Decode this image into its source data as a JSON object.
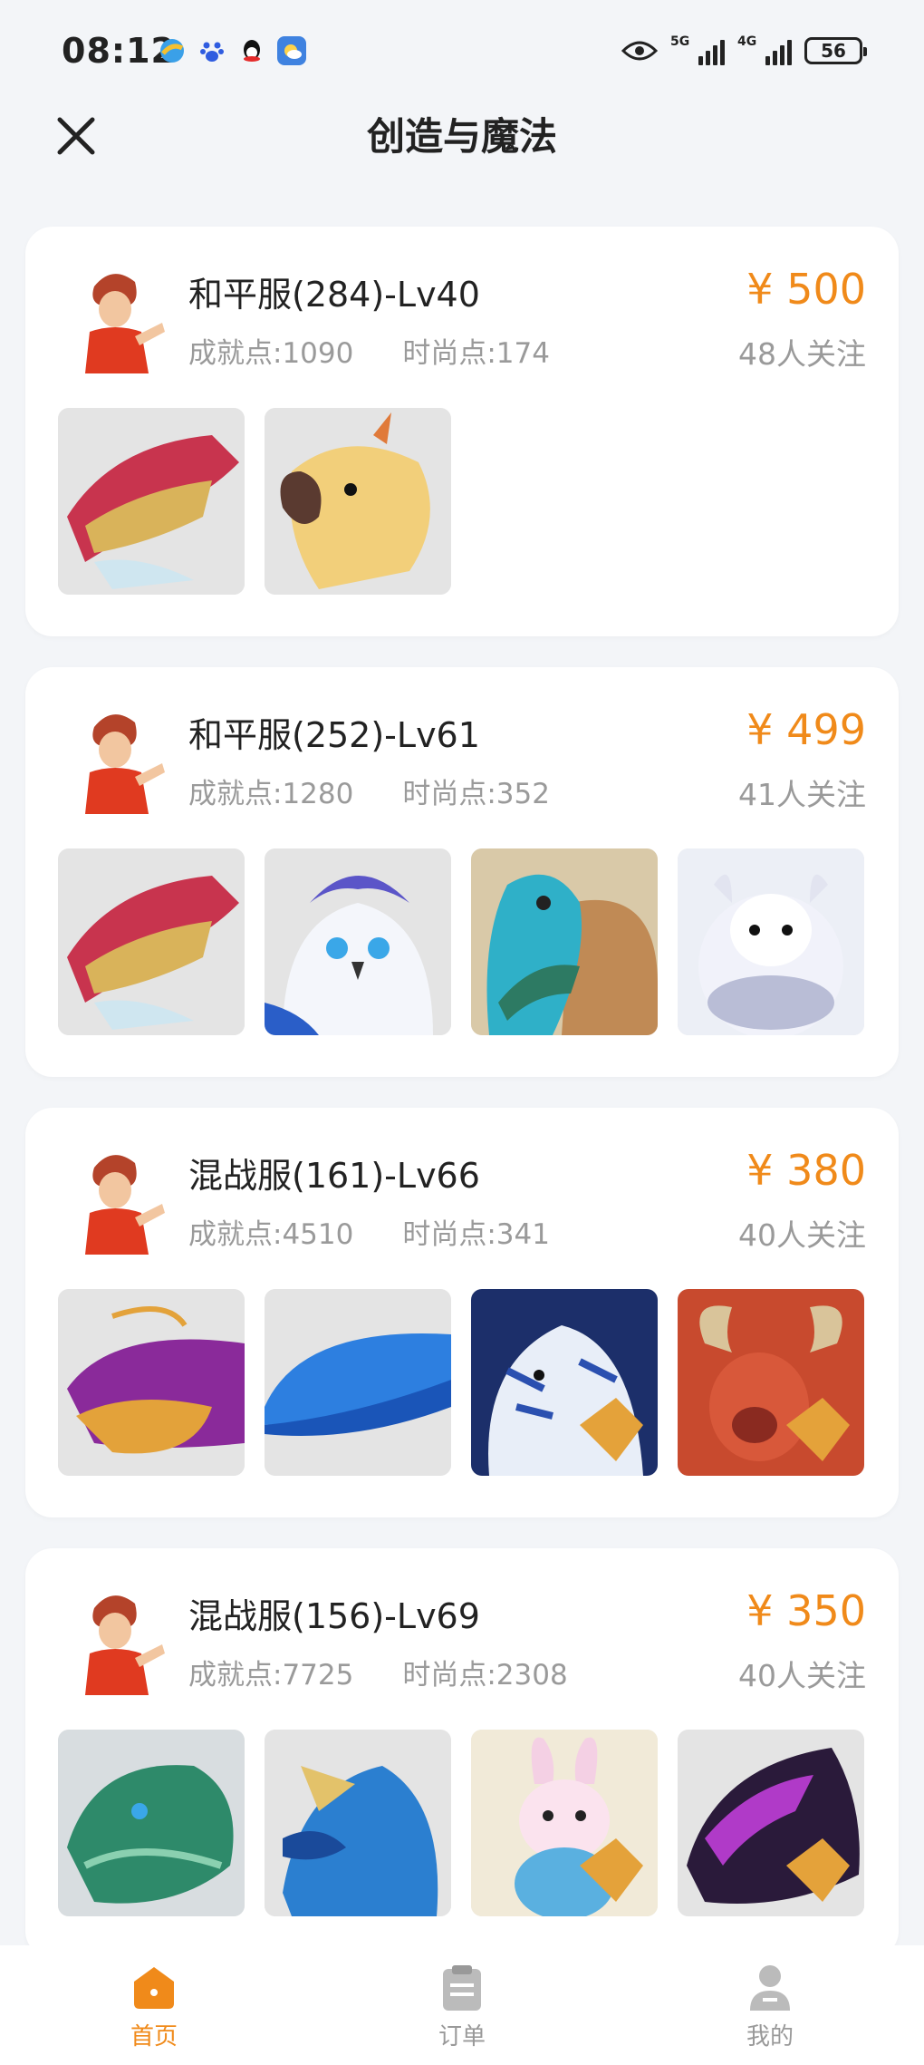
{
  "status": {
    "time": "08:12",
    "net1": "5G",
    "net2": "4G",
    "battery": "56"
  },
  "header": {
    "title": "创造与魔法"
  },
  "listings": [
    {
      "server": "和平服(284)-Lv40",
      "achievement": "成就点:1090",
      "fashion": "时尚点:174",
      "price": "¥ 500",
      "followers": "48人关注",
      "pets": [
        "red-dragon",
        "golden-parrot"
      ]
    },
    {
      "server": "和平服(252)-Lv61",
      "achievement": "成就点:1280",
      "fashion": "时尚点:352",
      "price": "¥ 499",
      "followers": "41人关注",
      "pets": [
        "red-dragon",
        "white-owl",
        "teal-dinosaur",
        "white-cow"
      ]
    },
    {
      "server": "混战服(161)-Lv66",
      "achievement": "成就点:4510",
      "fashion": "时尚点:341",
      "price": "¥ 380",
      "followers": "40人关注",
      "pets": [
        "golden-fish",
        "blue-whale",
        "white-tiger",
        "red-bull"
      ]
    },
    {
      "server": "混战服(156)-Lv69",
      "achievement": "成就点:7725",
      "fashion": "时尚点:2308",
      "price": "¥ 350",
      "followers": "40人关注",
      "pets": [
        "green-dragon",
        "blue-phoenix",
        "pink-rabbit",
        "purple-dragon"
      ]
    }
  ],
  "nav": {
    "home": "首页",
    "orders": "订单",
    "mine": "我的"
  },
  "colors": {
    "accent": "#f08a1a",
    "background": "#f3f5f8"
  }
}
